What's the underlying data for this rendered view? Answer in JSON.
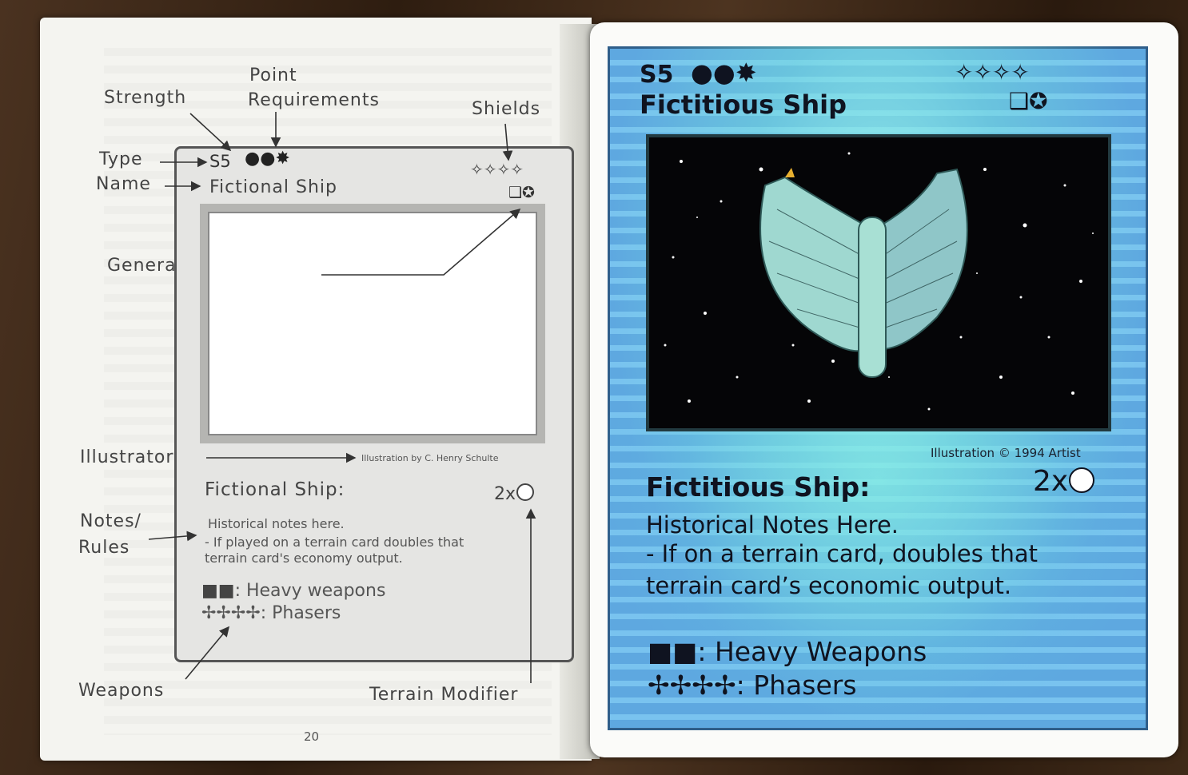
{
  "booklet": {
    "labels": {
      "strength": "Strength",
      "point_requirements_1": "Point",
      "point_requirements_2": "Requirements",
      "shields": "Shields",
      "type": "Type",
      "name": "Name",
      "generated_points": "Generated Points",
      "illustrator": "Illustrator",
      "notes_1": "Notes/",
      "notes_2": "Rules",
      "weapons": "Weapons",
      "terrain_modifier": "Terrain Modifier"
    },
    "diagram": {
      "type_strength": "S5",
      "point_req_symbols": "●●✸",
      "shield_symbols": "✧✧✧✧",
      "name": "Fictional Ship",
      "generated_points_symbols": "❑✪",
      "illustration_credit": "Illustration by C. Henry Schulte",
      "title2": "Fictional Ship:",
      "modifier": "2x",
      "notes_1": "Historical notes here.",
      "notes_2": "- If played on a terrain card doubles that",
      "notes_3": "terrain card's economy output.",
      "weapon_1_symbols": "■■",
      "weapon_1_text": ":  Heavy weapons",
      "weapon_2_symbols": "✢✢✢✢",
      "weapon_2_text": ": Phasers"
    },
    "page_number": "20"
  },
  "card": {
    "type_strength": "S5",
    "point_req_symbols": "●●✸",
    "shield_symbols": "✧✧✧✧",
    "name": "Fictitious Ship",
    "generated_points_symbols": "❑✪",
    "illustration_credit": "Illustration © 1994 Artist",
    "title2": "Fictitious Ship:",
    "modifier": "2x",
    "notes_1": "Historical Notes Here.",
    "notes_2": "- If on a terrain card, doubles that",
    "notes_3": "terrain card’s economic output.",
    "weapon_1_symbols": "■■",
    "weapon_1_text": ": Heavy Weapons",
    "weapon_2_symbols": "✢✢✢✢",
    "weapon_2_text": ": Phasers"
  },
  "colors": {
    "card_blue": "#5ea8e0",
    "card_glow": "#a0ffeb",
    "page": "#f4f4f0",
    "wood": "#3a2718"
  }
}
